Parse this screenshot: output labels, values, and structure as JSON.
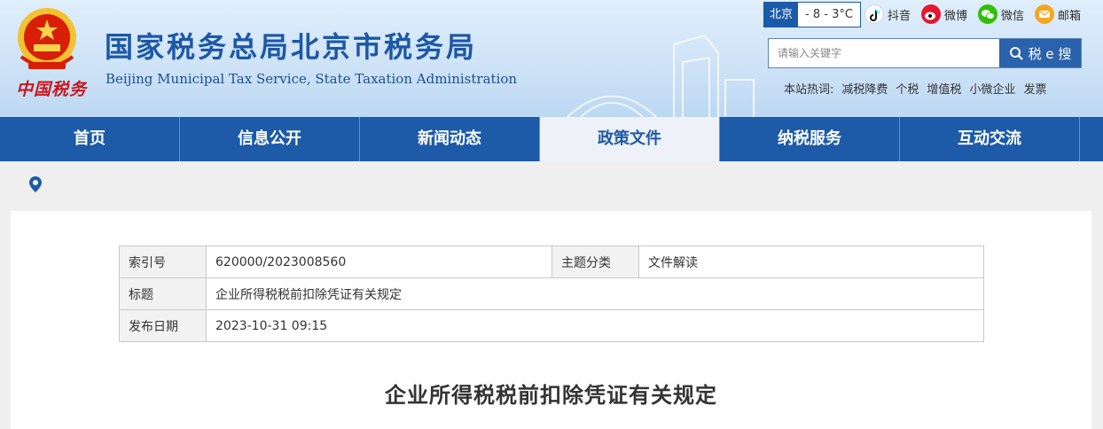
{
  "header": {
    "title": "国家税务总局北京市税务局",
    "subtitle": "Beijing Municipal Tax Service, State Taxation Administration",
    "brand_script": "中国税务"
  },
  "weather": {
    "city": "北京",
    "temp": "- 8 - 3°C"
  },
  "social": {
    "douyin": "抖音",
    "weibo": "微博",
    "weixin": "微信",
    "mail": "邮箱"
  },
  "search": {
    "placeholder": "请输入关键字",
    "button": "税 e 搜"
  },
  "hot": {
    "label": "本站热词:",
    "words": [
      "减税降费",
      "个税",
      "增值税",
      "小微企业",
      "发票"
    ]
  },
  "nav": {
    "items": [
      "首页",
      "信息公开",
      "新闻动态",
      "政策文件",
      "纳税服务",
      "互动交流"
    ],
    "active": "政策文件"
  },
  "meta": {
    "index_label": "索引号",
    "index_value": "620000/2023008560",
    "topic_label": "主题分类",
    "topic_value": "文件解读",
    "title_label": "标题",
    "title_value": "企业所得税税前扣除凭证有关规定",
    "date_label": "发布日期",
    "date_value": "2023-10-31 09:15"
  },
  "article": {
    "title": "企业所得税税前扣除凭证有关规定"
  },
  "colors": {
    "primary": "#1d5aa8",
    "emblem_red": "#c8161d",
    "active_nav_bg": "#eef2f8"
  }
}
